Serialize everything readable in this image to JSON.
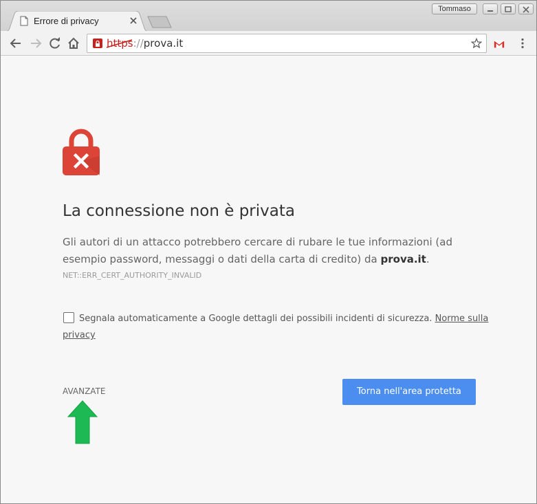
{
  "browser": {
    "tab": {
      "title": "Errore di privacy",
      "icon": "page-icon"
    },
    "profile_name": "Tommaso",
    "address": {
      "scheme": "https",
      "separator": "://",
      "host": "prova.it"
    },
    "toolbar_icons": [
      "back-arrow-icon",
      "forward-arrow-icon",
      "reload-icon",
      "home-icon",
      "bookmark-star-icon",
      "gmail-icon",
      "menu-dots-icon"
    ]
  },
  "interstitial": {
    "heading": "La connessione non è privata",
    "paragraph_before": "Gli autori di un attacco potrebbero cercare di rubare le tue informazioni (ad esempio password, messaggi o dati della carta di credito) da ",
    "paragraph_host": "prova.it",
    "paragraph_after": ".",
    "error_code": "NET::ERR_CERT_AUTHORITY_INVALID",
    "report_checkbox_checked": false,
    "report_text": "Segnala automaticamente a Google dettagli dei possibili incidenti di sicurezza. ",
    "privacy_link": "Norme sulla privacy",
    "advanced_label": "AVANZATE",
    "back_button_label": "Torna nell'area protetta"
  },
  "colors": {
    "danger_red": "#db4437",
    "primary_blue": "#4b8ef0",
    "annotation_green": "#1db954"
  }
}
